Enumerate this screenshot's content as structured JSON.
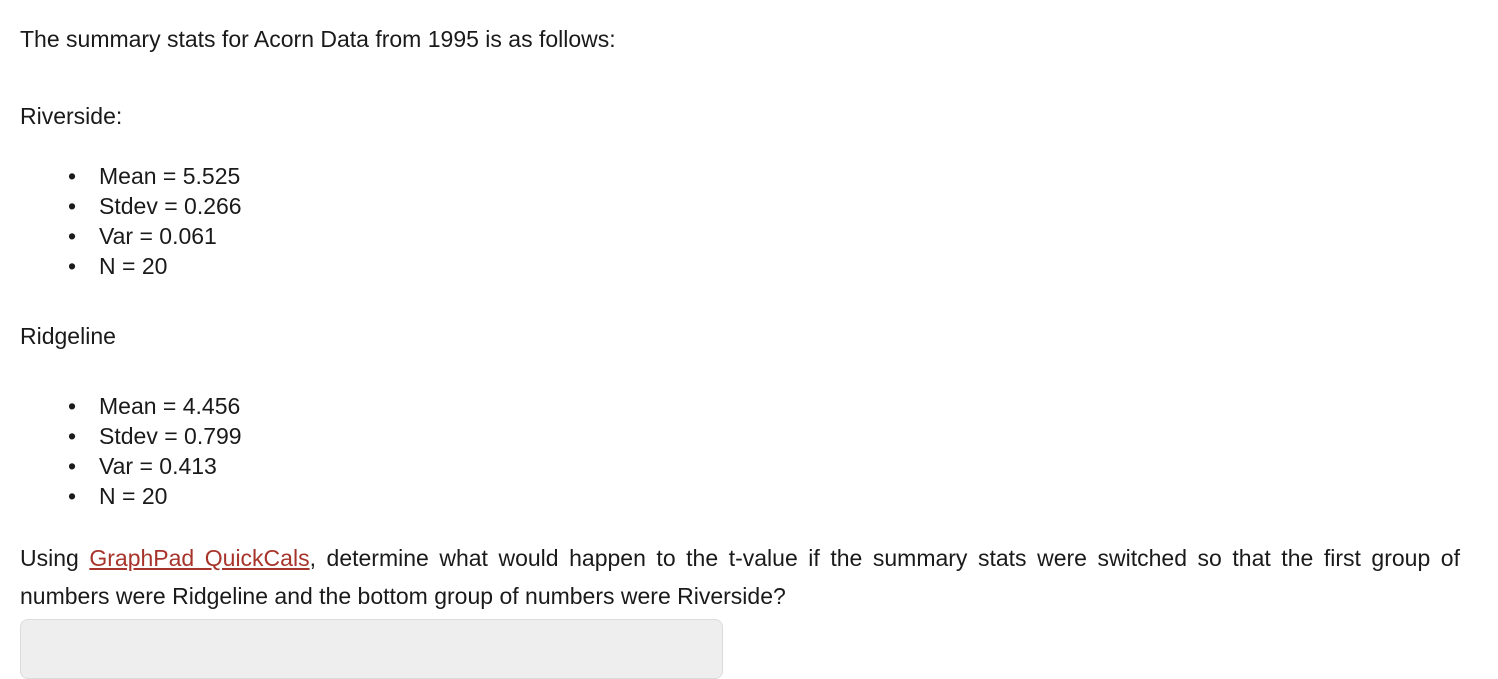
{
  "document": {
    "intro": "The summary stats for Acorn Data from 1995 is as follows:",
    "groups": [
      {
        "heading": "Riverside:",
        "stats": [
          "Mean = 5.525",
          "Stdev = 0.266",
          "Var = 0.061",
          "N = 20"
        ]
      },
      {
        "heading": "Ridgeline",
        "stats": [
          "Mean = 4.456",
          "Stdev = 0.799",
          "Var = 0.413",
          "N = 20"
        ]
      }
    ],
    "closing": {
      "prefix": "Using ",
      "link_text": "GraphPad QuickCals",
      "suffix": ", determine what would happen to the t-value if the summary stats were switched so that the first group of numbers were Ridgeline and the bottom group of numbers were Riverside?"
    },
    "bullet_glyph": "•",
    "link_color": "#a6342a",
    "text_color": "#1a1a1a",
    "background_color": "#ffffff",
    "answer_field_value": ""
  }
}
